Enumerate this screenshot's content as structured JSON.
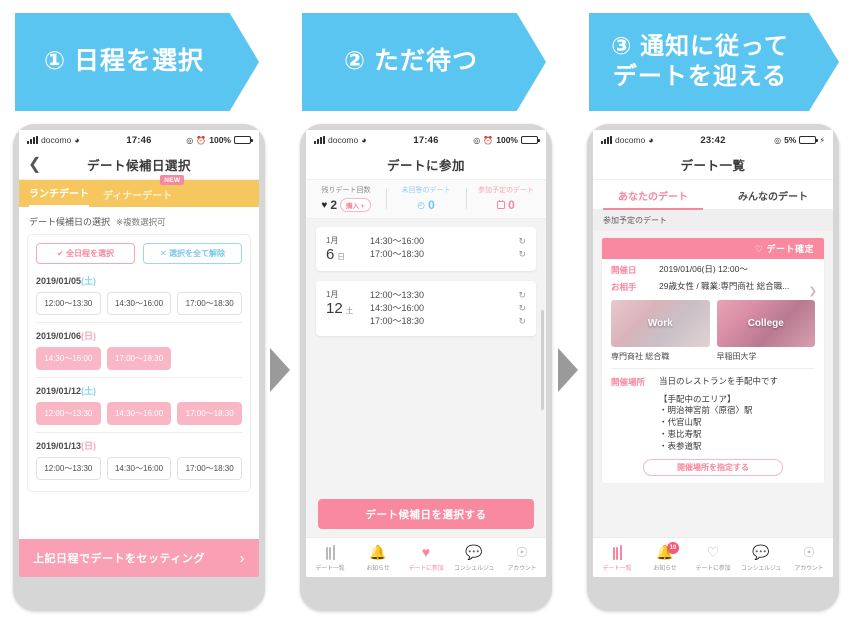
{
  "steps": [
    {
      "label": "① 日程を選択"
    },
    {
      "label": "② ただ待つ"
    },
    {
      "label": "③ 通知に従って\nデートを迎える"
    }
  ],
  "step3_line1": "③ 通知に従って",
  "step3_line2": "デートを迎える",
  "screen1": {
    "status": {
      "carrier": "docomo",
      "time": "17:46",
      "battery": "100%"
    },
    "navbar": {
      "title": "デート候補日選択",
      "back_icon": "chevron-left-icon"
    },
    "tabs": [
      {
        "label": "ランチデート",
        "active": true
      },
      {
        "label": "ディナーデート",
        "active": false,
        "badge": "NEW"
      }
    ],
    "section_label": "デート候補日の選択",
    "section_sub": "※複数選択可",
    "select_all": "✔ 全日程を選択",
    "clear_all": "✕ 選択を全て解除",
    "days": [
      {
        "date": "2019/01/05",
        "dow": "(土)",
        "dow_type": "sat",
        "slots": [
          {
            "label": "12:00〜13:30",
            "selected": false
          },
          {
            "label": "14:30〜16:00",
            "selected": false
          },
          {
            "label": "17:00〜18:30",
            "selected": false
          }
        ]
      },
      {
        "date": "2019/01/06",
        "dow": "(日)",
        "dow_type": "sun",
        "slots": [
          {
            "label": "14:30〜16:00",
            "selected": true
          },
          {
            "label": "17:00〜18:30",
            "selected": true
          }
        ]
      },
      {
        "date": "2019/01/12",
        "dow": "(土)",
        "dow_type": "sat",
        "slots": [
          {
            "label": "12:00〜13:30",
            "selected": true
          },
          {
            "label": "14:30〜16:00",
            "selected": true
          },
          {
            "label": "17:00〜18:30",
            "selected": true
          }
        ]
      },
      {
        "date": "2019/01/13",
        "dow": "(日)",
        "dow_type": "sun",
        "slots": [
          {
            "label": "12:00〜13:30",
            "selected": false
          },
          {
            "label": "14:30〜16:00",
            "selected": false
          },
          {
            "label": "17:00〜18:30",
            "selected": false
          }
        ]
      }
    ],
    "cta": {
      "label": "上記日程でデートをセッティング",
      "chev": "›"
    }
  },
  "screen2": {
    "status": {
      "carrier": "docomo",
      "time": "17:46",
      "battery": "100%"
    },
    "navbar": {
      "title": "デートに参加"
    },
    "stats": [
      {
        "label": "残りデート回数",
        "value": "2",
        "icon": "heart-icon",
        "pill": "購入 +"
      },
      {
        "label": "未回答のデート",
        "value": "0",
        "icon": "clock-icon"
      },
      {
        "label": "参加予定のデート",
        "value": "0",
        "icon": "calendar-icon"
      }
    ],
    "cards": [
      {
        "month": "1月",
        "day": "6",
        "dow": "日",
        "times": [
          "14:30〜16:00",
          "17:00〜18:30"
        ]
      },
      {
        "month": "1月",
        "day": "12",
        "dow": "土",
        "times": [
          "12:00〜13:30",
          "14:30〜16:00",
          "17:00〜18:30"
        ]
      }
    ],
    "cta": "デート候補日を選択する",
    "bottomnav": [
      {
        "label": "デート一覧",
        "icon": "cutlery-icon",
        "active": false
      },
      {
        "label": "お知らせ",
        "icon": "bell-icon",
        "active": false
      },
      {
        "label": "デートに参加",
        "icon": "heart-filled-icon",
        "active": true
      },
      {
        "label": "コンシェルジュ",
        "icon": "chat-icon",
        "active": false
      },
      {
        "label": "アカウント",
        "icon": "account-icon",
        "active": false
      }
    ]
  },
  "screen3": {
    "status": {
      "carrier": "docomo",
      "time": "23:42",
      "battery": "5%"
    },
    "navbar": {
      "title": "デート一覧"
    },
    "tabs": [
      {
        "label": "あなたのデート",
        "active": true
      },
      {
        "label": "みんなのデート",
        "active": false
      }
    ],
    "section_header": "参加予定のデート",
    "card_banner": "♡ デート確定",
    "rows": [
      {
        "key": "開催日",
        "value": "2019/01/06(日) 12:00〜"
      },
      {
        "key": "お相手",
        "value": "29歳女性 / 職業:専門商社 総合職..."
      }
    ],
    "photos": [
      {
        "tag": "Work",
        "caption": "専門商社 総合職"
      },
      {
        "tag": "College",
        "caption": "早稲田大学"
      }
    ],
    "venue": {
      "key": "開催場所",
      "value": "当日のレストランを手配中です",
      "area_heading": "【手配中のエリア】",
      "areas": [
        "・明治神宮前〈原宿〉駅",
        "・代官山駅",
        "・恵比寿駅",
        "・表参道駅"
      ],
      "button": "開催場所を指定する"
    },
    "bottomnav": [
      {
        "label": "デート一覧",
        "icon": "cutlery-icon",
        "active": true
      },
      {
        "label": "お知らせ",
        "icon": "bell-icon",
        "active": false,
        "badge": "10"
      },
      {
        "label": "デートに参加",
        "icon": "heart-outline-icon",
        "active": false
      },
      {
        "label": "コンシェルジュ",
        "icon": "chat-icon",
        "active": false
      },
      {
        "label": "アカウント",
        "icon": "account-icon",
        "active": false
      }
    ]
  },
  "colors": {
    "banner_blue": "#5bc5f2",
    "pink": "#f7879f",
    "pink_light": "#f9b6c4",
    "orange": "#f5c75e",
    "blue_light": "#8fd3ef"
  }
}
